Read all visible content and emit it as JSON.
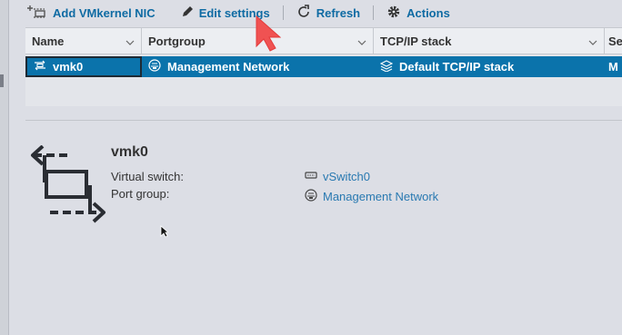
{
  "toolbar": {
    "add_vmkernel_nic": "Add VMkernel NIC",
    "edit_settings": "Edit settings",
    "refresh": "Refresh",
    "actions": "Actions"
  },
  "grid": {
    "columns": [
      "Name",
      "Portgroup",
      "TCP/IP stack",
      "Se"
    ],
    "rows": [
      {
        "name": "vmk0",
        "portgroup": "Management Network",
        "tcpip_stack": "Default TCP/IP stack",
        "extra": "M"
      }
    ]
  },
  "details": {
    "title": "vmk0",
    "virtual_switch_label": "Virtual switch:",
    "virtual_switch_value": "vSwitch0",
    "port_group_label": "Port group:",
    "port_group_value": "Management Network"
  },
  "colors": {
    "link": "#0f6ba3",
    "selected_row": "#0b73ab",
    "cursor": "#f05252"
  }
}
